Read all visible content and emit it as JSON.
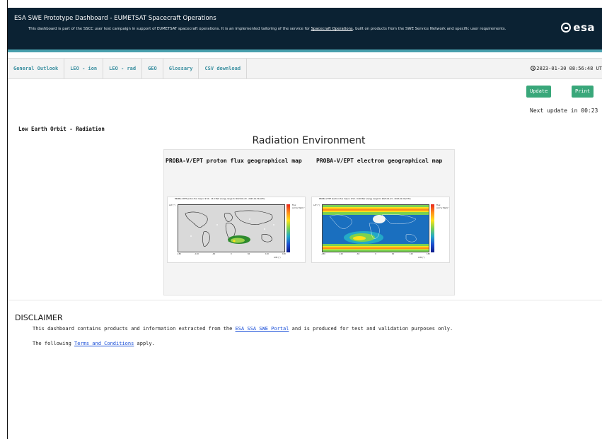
{
  "header": {
    "title": "ESA SWE Prototype Dashboard - EUMETSAT Spacecraft Operations",
    "subtitle_pre": "This dashboard is part of the SSCC user test campaign in support of EUMETSAT spacecraft operations. It is an implemented tailoring of the service for ",
    "subtitle_link": "Spacecraft Operations",
    "subtitle_post": ", built on products from the SWE Service Network and specific user requirements.",
    "logo_text": "esa"
  },
  "nav": {
    "tabs": [
      "General Outlook",
      "LEO - ion",
      "LEO - rad",
      "GEO",
      "Glossary",
      "CSV download"
    ],
    "datetime": "2023-01-30 08:56:48 UT"
  },
  "controls": {
    "update_label": "Update",
    "print_label": "Print",
    "next_update": "Next update in 00:23"
  },
  "section": {
    "title": "Low Earth Orbit - Radiation",
    "heading": "Radiation Environment"
  },
  "maps": {
    "proton_caption": "PROBA-V/EPT proton flux geographical map",
    "electron_caption": "PROBA-V/EPT electron geographical map",
    "proton_plot_title": "PROBA-V EPT proton flux map in 9.50 - 13.0 MeV energy range for 2023-01-23 - 2023-01-30 (UTC)",
    "electron_plot_title": "PROBA-V EPT electron flux map in 0.50 - 0.60 MeV energy range for 2023-01-23 - 2023-01-30 (UTC)",
    "y_axis": "LAT (°)",
    "x_axis": "LON (°)",
    "legend_flux": "Flux",
    "proton_unit": "(cm²sr MeV)⁻¹",
    "electron_unit": "(cm²sr MeV)⁻¹",
    "x_ticks": [
      "-180",
      "-120",
      "-60",
      "0",
      "60",
      "120",
      "180"
    ],
    "y_ticks": [
      "80",
      "40",
      "0",
      "-40",
      "-80"
    ]
  },
  "disclaimer": {
    "title": "DISCLAIMER",
    "line1_pre": "This dashboard contains products and information extracted from the ",
    "line1_link": "ESA SSA SWE Portal",
    "line1_post": " and is produced for test and validation purposes only.",
    "line2_pre": "The following ",
    "line2_link": "Terms and Conditions",
    "line2_post": " apply."
  },
  "colors": {
    "header_bg": "#0b2233",
    "header_accent": "#49a0ad",
    "nav_text": "#3a8fa0",
    "button_green": "#39a77a",
    "link_blue": "#1a4fd8"
  }
}
